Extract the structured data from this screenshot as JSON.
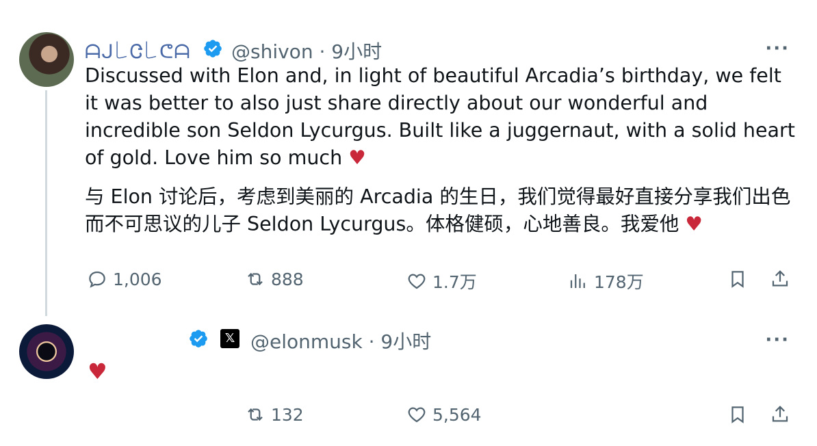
{
  "tweet1": {
    "display_name": "ᗩᒍ꒒Ꮳ꒒ᕦᗩ",
    "handle": "@shivon · 9小时",
    "text_en": "Discussed with Elon and, in light of beautiful Arcadia’s birthday, we felt it was better to also just share directly about our wonderful and incredible son Seldon Lycurgus. Built like a juggernaut, with a solid heart of gold. Love him so much",
    "text_en_heart": "♥",
    "text_zh": "与 Elon 讨论后，考虑到美丽的 Arcadia 的生日，我们觉得最好直接分享我们出色而不可思议的儿子 Seldon Lycurgus。体格健硕，心地善良。我爱他",
    "text_zh_heart": "♥",
    "more": "···",
    "actions": {
      "replies": "1,006",
      "retweets": "888",
      "likes": "1.7万",
      "views": "178万"
    }
  },
  "tweet2": {
    "x_badge": "𝕏",
    "handle": "@elonmusk · 9小时",
    "text": "♥",
    "more": "···",
    "actions": {
      "retweets": "132",
      "likes": "5,564"
    }
  },
  "colors": {
    "verified": "#1d9bf0",
    "heart": "#c9283a",
    "muted": "#536471"
  }
}
